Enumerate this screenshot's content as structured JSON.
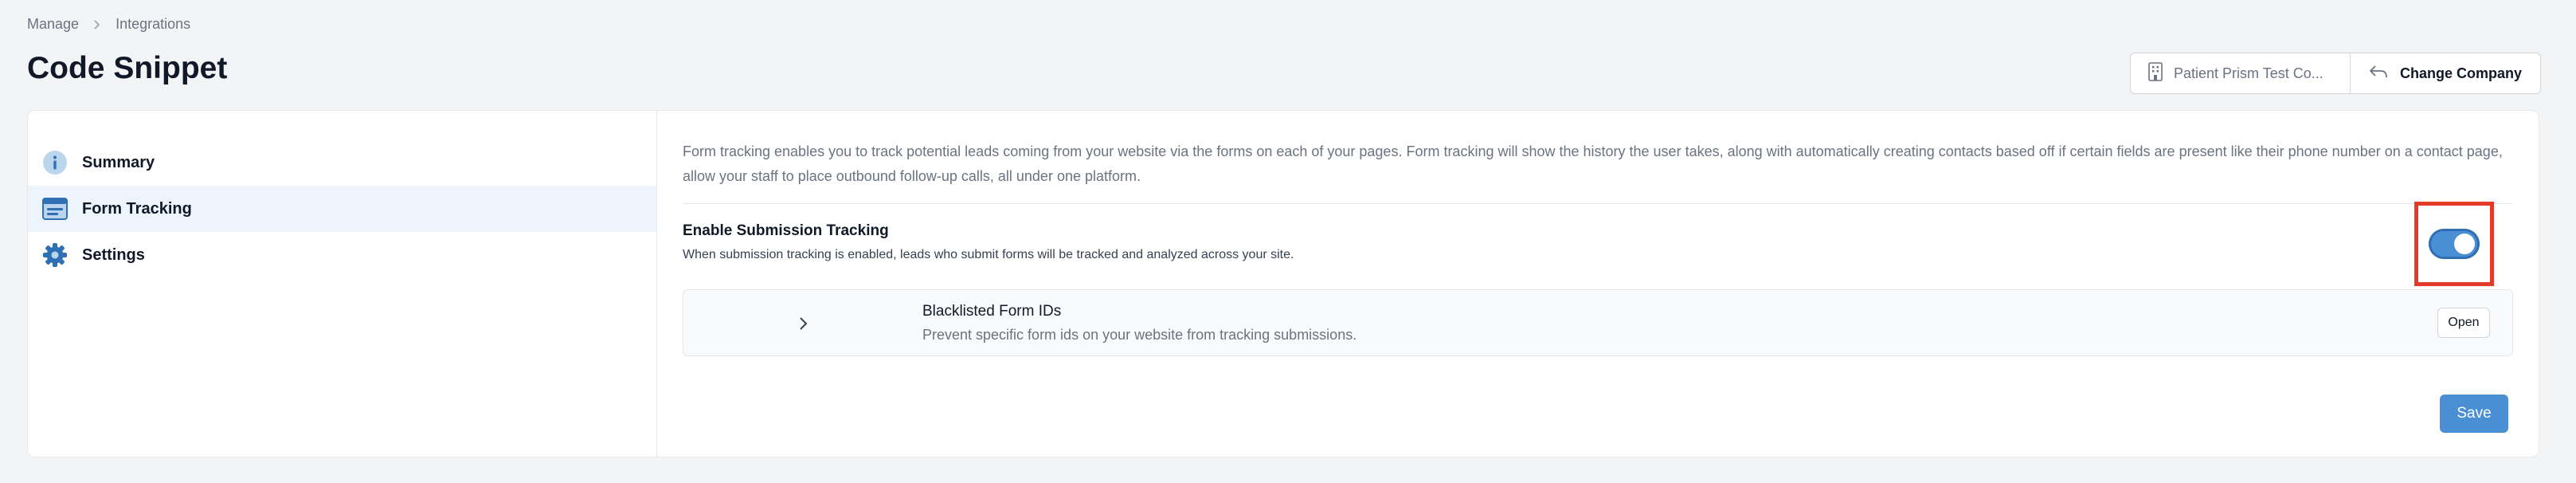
{
  "breadcrumb": {
    "items": [
      "Manage",
      "Integrations"
    ]
  },
  "page": {
    "title": "Code Snippet"
  },
  "top_actions": {
    "company_label": "Patient Prism Test Co...",
    "change_company_label": "Change Company"
  },
  "sidebar": {
    "items": [
      {
        "label": "Summary",
        "icon": "info-icon"
      },
      {
        "label": "Form Tracking",
        "icon": "form-window-icon",
        "active": true
      },
      {
        "label": "Settings",
        "icon": "gear-icon"
      }
    ]
  },
  "main": {
    "description": "Form tracking enables you to track potential leads coming from your website via the forms on each of your pages. Form tracking will show the history the user takes, along with automatically creating contacts based off if certain fields are present like their phone number on a contact page, allow your staff to place outbound follow-up calls, all under one platform.",
    "submission_tracking": {
      "title": "Enable Submission Tracking",
      "description": "When submission tracking is enabled, leads who submit forms will be tracked and analyzed across your site.",
      "enabled": true
    },
    "blacklist": {
      "title": "Blacklisted Form IDs",
      "description": "Prevent specific form ids on your website from tracking submissions.",
      "open_label": "Open"
    },
    "save_label": "Save"
  },
  "colors": {
    "accent": "#4a8fd4",
    "highlight_border": "#e53a2a",
    "active_item_bg": "#eef4fb"
  }
}
